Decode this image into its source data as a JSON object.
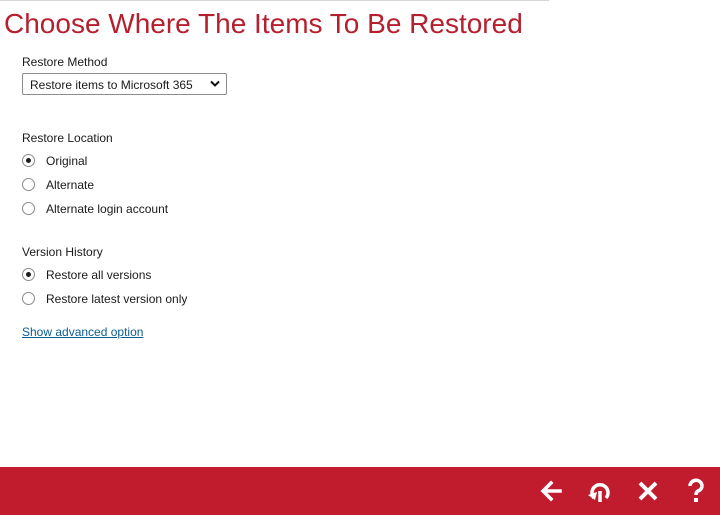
{
  "title": "Choose Where The Items To Be Restored",
  "restore_method": {
    "label": "Restore Method",
    "selected": "Restore items to Microsoft 365"
  },
  "restore_location": {
    "label": "Restore Location",
    "options": [
      {
        "label": "Original",
        "checked": true
      },
      {
        "label": "Alternate",
        "checked": false
      },
      {
        "label": "Alternate login account",
        "checked": false
      }
    ]
  },
  "version_history": {
    "label": "Version History",
    "options": [
      {
        "label": "Restore all versions",
        "checked": true
      },
      {
        "label": "Restore latest version only",
        "checked": false
      }
    ]
  },
  "advanced_link": "Show advanced option",
  "footer": {
    "bar_color": "#c01c2d",
    "buttons": [
      {
        "icon": "arrow-left-icon"
      },
      {
        "icon": "restore-icon"
      },
      {
        "icon": "close-icon"
      },
      {
        "icon": "help-icon"
      }
    ]
  },
  "colors": {
    "title": "#b51f2e",
    "link": "#0b5c91"
  }
}
